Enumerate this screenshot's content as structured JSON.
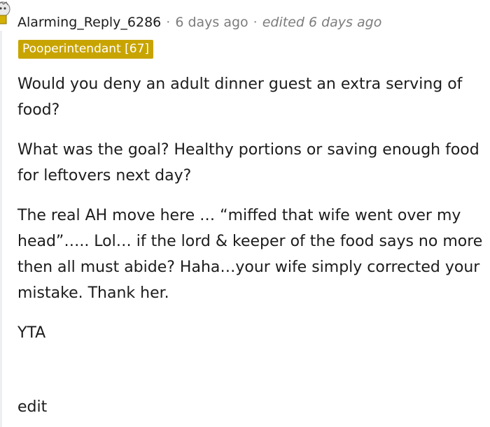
{
  "comment": {
    "username": "Alarming_Reply_6286",
    "timestamp": "6 days ago",
    "edited_label": "edited 6 days ago",
    "separator": "·",
    "flair": "Pooperintendant [67]",
    "paragraphs": [
      "Would you deny an adult dinner guest an extra serving of food?",
      "What was the goal? Healthy portions or saving enough food for leftovers next day?",
      "The real AH move here … “miffed that wife went over my head”….. Lol… if the lord & keeper of the food says no more then all must abide? Haha…your wife simply corrected your mistake. Thank her.",
      "YTA"
    ],
    "edit_label": "edit"
  },
  "colors": {
    "flair_bg": "#c8a400",
    "meta_text": "#7c7c7c",
    "thread_line": "#edeff1"
  },
  "icons": {
    "avatar": "avatar-icon"
  }
}
